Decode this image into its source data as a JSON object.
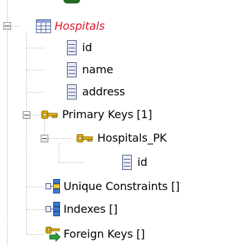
{
  "tree": {
    "table": {
      "label": "Hospitals",
      "color": "#e0142a",
      "icon": "table-icon"
    },
    "columns": [
      {
        "label": "id",
        "icon": "column-icon"
      },
      {
        "label": "name",
        "icon": "column-icon"
      },
      {
        "label": "address",
        "icon": "column-icon"
      }
    ],
    "primary_keys": {
      "label": "Primary Keys [1]",
      "icon": "key-icon",
      "children": [
        {
          "label": "Hospitals_PK",
          "icon": "key-icon",
          "children": [
            {
              "label": "id",
              "icon": "column-icon"
            }
          ]
        }
      ]
    },
    "unique_constraints": {
      "label": "Unique Constraints []",
      "icon": "unique-constraint-icon"
    },
    "indexes": {
      "label": "Indexes []",
      "icon": "index-icon"
    },
    "foreign_keys": {
      "label": "Foreign Keys []",
      "icon": "foreign-key-icon"
    }
  },
  "colors": {
    "text": "#000000",
    "table_label": "#e0142a",
    "guide_line": "#9a9a9a",
    "column_icon_fill": "#e9ecf5",
    "column_icon_stroke": "#4a5a8c",
    "key_gold": "#e1b214",
    "index_blue": "#3a7ad0",
    "fk_green": "#2f9a3a"
  }
}
